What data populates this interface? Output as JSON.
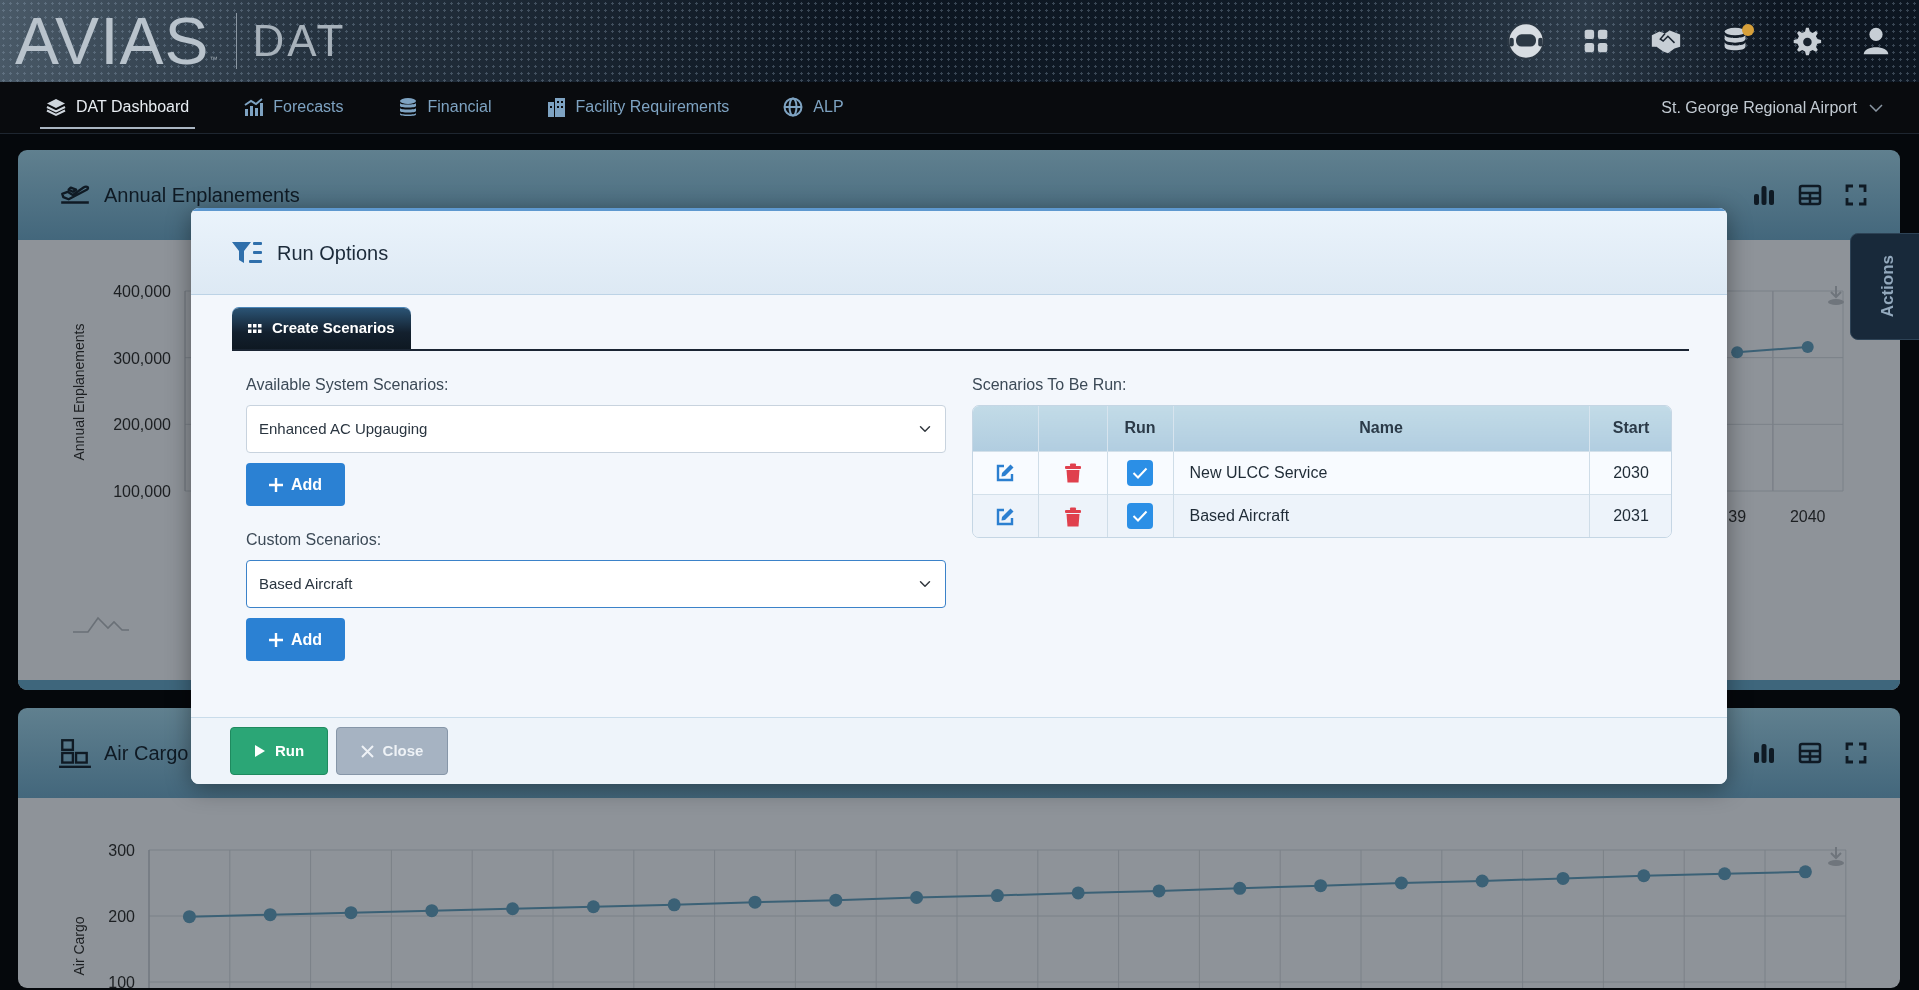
{
  "header": {
    "logo": "AVIAS",
    "trademark": "™",
    "product": "DAT",
    "alert_dot": true
  },
  "nav": [
    {
      "label": "DAT Dashboard",
      "selected": true
    },
    {
      "label": "Forecasts",
      "selected": false
    },
    {
      "label": "Financial",
      "selected": false
    },
    {
      "label": "Facility Requirements",
      "selected": false
    },
    {
      "label": "ALP",
      "selected": false
    }
  ],
  "airport_selector": {
    "value": "St. George Regional Airport"
  },
  "panels": [
    {
      "title": "Annual Enplanements",
      "chart_data": {
        "type": "line",
        "marker": true,
        "ylim": [
          100000,
          400000
        ],
        "ylabel": "Annual Enplanements",
        "yticks": [
          {
            "value": 100000,
            "label": "100,000"
          },
          {
            "value": 200000,
            "label": "200,000"
          },
          {
            "value": 300000,
            "label": "300,000"
          },
          {
            "value": 400000,
            "label": "400,000"
          }
        ],
        "x": [
          2039,
          2040
        ],
        "xlim": [
          2017,
          2040.5
        ],
        "xticks": [
          {
            "value": 2039,
            "label": "39"
          },
          {
            "value": 2040,
            "label": "2040"
          }
        ],
        "values": [
          308000,
          316000
        ]
      }
    },
    {
      "title": "Air Cargo",
      "chart_data": {
        "type": "line",
        "marker": true,
        "ylim": [
          90,
          300
        ],
        "ylabel": "Air Cargo",
        "yticks": [
          100,
          200,
          300
        ],
        "values": [
          199,
          202,
          205,
          208,
          211,
          214,
          217,
          221,
          224,
          228,
          231,
          235,
          238,
          242,
          246,
          250,
          253,
          257,
          261,
          264,
          267
        ]
      }
    }
  ],
  "actions_tab": "Actions",
  "modal": {
    "title": "Run Options",
    "tabs": [
      {
        "label": "Create Scenarios",
        "selected": true
      }
    ],
    "system_label": "Available System Scenarios:",
    "system_value": "Enhanced AC Upgauging",
    "system_add": "Add",
    "custom_label": "Custom Scenarios:",
    "custom_value": "Based Aircraft",
    "custom_focused": true,
    "custom_add": "Add",
    "table_title": "Scenarios To Be Run:",
    "columns": [
      "Run",
      "Name",
      "Start"
    ],
    "rows": [
      {
        "run": true,
        "name": "New ULCC Service",
        "start": "2030"
      },
      {
        "run": true,
        "name": "Based Aircraft",
        "start": "2031"
      }
    ],
    "footer_buttons": [
      {
        "label": "Run",
        "kind": "run"
      },
      {
        "label": "Close",
        "kind": "close"
      }
    ]
  }
}
